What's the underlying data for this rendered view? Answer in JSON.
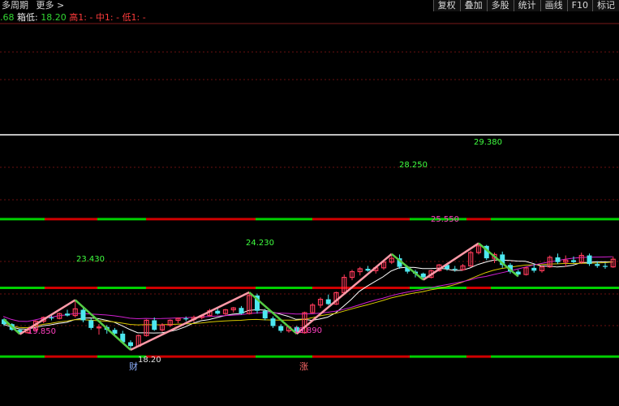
{
  "toolbar": {
    "left": [
      "多周期",
      "更多 >"
    ],
    "right": [
      "复权",
      "叠加",
      "多股",
      "统计",
      "画线",
      "F10",
      "标记"
    ]
  },
  "legend": {
    "prefix_value": ".68",
    "box_low_label": "箱低:",
    "box_low_value": "18.20",
    "high_label": "高1: -",
    "mid_label": "中1: -",
    "low_label": "低1: -"
  },
  "colors": {
    "up": "#ff3a5a",
    "down": "#4de8f0",
    "zigzag_up": "#ff9aa8",
    "zigzag_down": "#55cc44",
    "level_green": "#00d000",
    "level_red": "#d00000",
    "ma_white": "#ffffff",
    "ma_yellow": "#d8c800",
    "ma_magenta": "#d020d0",
    "label_magenta": "#ff40c0",
    "label_green": "#40ff40"
  },
  "annotations": {
    "low1": "19.850",
    "high1": "23.430",
    "low2": "18.20",
    "high2": "24.230",
    "low3": "19.890",
    "high3": "28.250",
    "low4": "25.550",
    "high4": "29.380",
    "event_cai": "财",
    "event_zhang": "涨"
  },
  "chart_data": {
    "type": "candlestick",
    "title": "",
    "ohlc": [
      [
        21.4,
        21.5,
        20.7,
        20.9
      ],
      [
        20.9,
        21.0,
        20.2,
        20.3
      ],
      [
        20.3,
        20.4,
        19.85,
        20.0
      ],
      [
        20.0,
        20.4,
        19.9,
        20.3
      ],
      [
        20.3,
        21.3,
        20.2,
        21.2
      ],
      [
        21.2,
        21.7,
        21.0,
        21.6
      ],
      [
        21.6,
        21.8,
        21.3,
        21.5
      ],
      [
        21.5,
        22.1,
        21.4,
        22.0
      ],
      [
        22.0,
        22.4,
        21.7,
        21.8
      ],
      [
        21.8,
        23.43,
        21.6,
        22.5
      ],
      [
        22.4,
        22.6,
        21.1,
        21.3
      ],
      [
        21.3,
        21.5,
        20.3,
        20.5
      ],
      [
        20.5,
        20.9,
        19.8,
        20.6
      ],
      [
        20.6,
        20.8,
        19.9,
        20.3
      ],
      [
        20.3,
        20.5,
        19.7,
        19.9
      ],
      [
        19.9,
        20.2,
        18.9,
        19.0
      ],
      [
        19.0,
        19.2,
        18.2,
        18.6
      ],
      [
        18.6,
        19.8,
        18.5,
        19.7
      ],
      [
        19.7,
        21.4,
        19.6,
        21.3
      ],
      [
        21.3,
        21.6,
        20.2,
        20.3
      ],
      [
        20.3,
        21.0,
        20.1,
        20.8
      ],
      [
        20.8,
        21.4,
        20.6,
        21.3
      ],
      [
        21.3,
        21.6,
        21.0,
        21.5
      ],
      [
        21.5,
        21.7,
        21.2,
        21.4
      ],
      [
        21.4,
        21.8,
        21.1,
        21.6
      ],
      [
        21.6,
        21.9,
        21.4,
        21.8
      ],
      [
        21.8,
        22.5,
        21.7,
        22.3
      ],
      [
        22.3,
        22.6,
        21.9,
        22.0
      ],
      [
        22.0,
        22.5,
        21.8,
        22.4
      ],
      [
        22.4,
        22.7,
        22.1,
        22.6
      ],
      [
        22.6,
        22.8,
        21.9,
        22.0
      ],
      [
        22.0,
        24.23,
        21.9,
        23.9
      ],
      [
        23.9,
        24.1,
        22.0,
        22.3
      ],
      [
        22.3,
        22.5,
        21.3,
        21.5
      ],
      [
        21.5,
        21.7,
        20.5,
        20.7
      ],
      [
        20.7,
        20.9,
        20.0,
        20.2
      ],
      [
        20.2,
        20.7,
        20.0,
        20.6
      ],
      [
        20.6,
        20.7,
        19.89,
        20.0
      ],
      [
        20.0,
        22.2,
        19.9,
        22.1
      ],
      [
        22.1,
        23.1,
        22.0,
        22.9
      ],
      [
        22.9,
        23.7,
        22.6,
        23.5
      ],
      [
        23.5,
        24.0,
        22.9,
        23.0
      ],
      [
        23.0,
        24.3,
        22.9,
        24.2
      ],
      [
        24.2,
        26.1,
        24.0,
        25.8
      ],
      [
        25.8,
        26.6,
        25.5,
        26.4
      ],
      [
        26.4,
        26.9,
        26.0,
        26.7
      ],
      [
        26.7,
        27.0,
        26.4,
        26.5
      ],
      [
        26.5,
        26.9,
        26.2,
        26.8
      ],
      [
        26.8,
        27.6,
        26.6,
        27.4
      ],
      [
        27.4,
        28.25,
        27.2,
        27.8
      ],
      [
        27.8,
        28.2,
        26.7,
        26.9
      ],
      [
        26.9,
        27.0,
        26.2,
        26.4
      ],
      [
        26.4,
        26.6,
        25.8,
        26.2
      ],
      [
        26.2,
        26.3,
        25.55,
        25.8
      ],
      [
        25.8,
        26.6,
        25.7,
        26.5
      ],
      [
        26.5,
        27.2,
        26.4,
        27.1
      ],
      [
        27.1,
        27.3,
        26.5,
        26.7
      ],
      [
        26.7,
        27.0,
        26.4,
        26.6
      ],
      [
        26.6,
        27.2,
        26.5,
        27.0
      ],
      [
        27.0,
        28.6,
        26.9,
        28.4
      ],
      [
        28.4,
        29.38,
        28.2,
        29.1
      ],
      [
        29.1,
        29.2,
        27.6,
        27.8
      ],
      [
        27.8,
        28.4,
        27.3,
        28.2
      ],
      [
        28.2,
        28.5,
        26.8,
        27.1
      ],
      [
        27.1,
        27.3,
        26.2,
        26.4
      ],
      [
        26.4,
        26.6,
        25.9,
        26.1
      ],
      [
        26.1,
        26.9,
        26.0,
        26.8
      ],
      [
        26.8,
        27.2,
        26.3,
        26.5
      ],
      [
        26.5,
        27.0,
        26.3,
        26.9
      ],
      [
        26.9,
        28.1,
        26.8,
        27.9
      ],
      [
        27.9,
        28.3,
        27.2,
        27.4
      ],
      [
        27.4,
        28.1,
        26.9,
        27.6
      ],
      [
        27.6,
        28.0,
        27.3,
        27.4
      ],
      [
        27.4,
        28.4,
        27.2,
        28.1
      ],
      [
        28.1,
        28.3,
        27.0,
        27.2
      ],
      [
        27.2,
        27.5,
        26.8,
        27.0
      ],
      [
        27.0,
        27.3,
        26.7,
        26.9
      ],
      [
        26.9,
        28.0,
        26.8,
        27.7
      ]
    ],
    "zigzag": [
      {
        "i": 0,
        "price": 21.4
      },
      {
        "i": 2,
        "price": 19.85
      },
      {
        "i": 9,
        "price": 23.43
      },
      {
        "i": 16,
        "price": 18.2
      },
      {
        "i": 31,
        "price": 24.23
      },
      {
        "i": 37,
        "price": 19.89
      },
      {
        "i": 49,
        "price": 28.25
      },
      {
        "i": 53,
        "price": 25.55
      },
      {
        "i": 60,
        "price": 29.38
      },
      {
        "i": 65,
        "price": 25.9
      }
    ],
    "levels": [
      {
        "price": 31.9,
        "color_key": "mixed"
      },
      {
        "price": 24.7,
        "color_key": "mixed"
      },
      {
        "price": 17.5,
        "color_key": "mixed"
      }
    ]
  }
}
